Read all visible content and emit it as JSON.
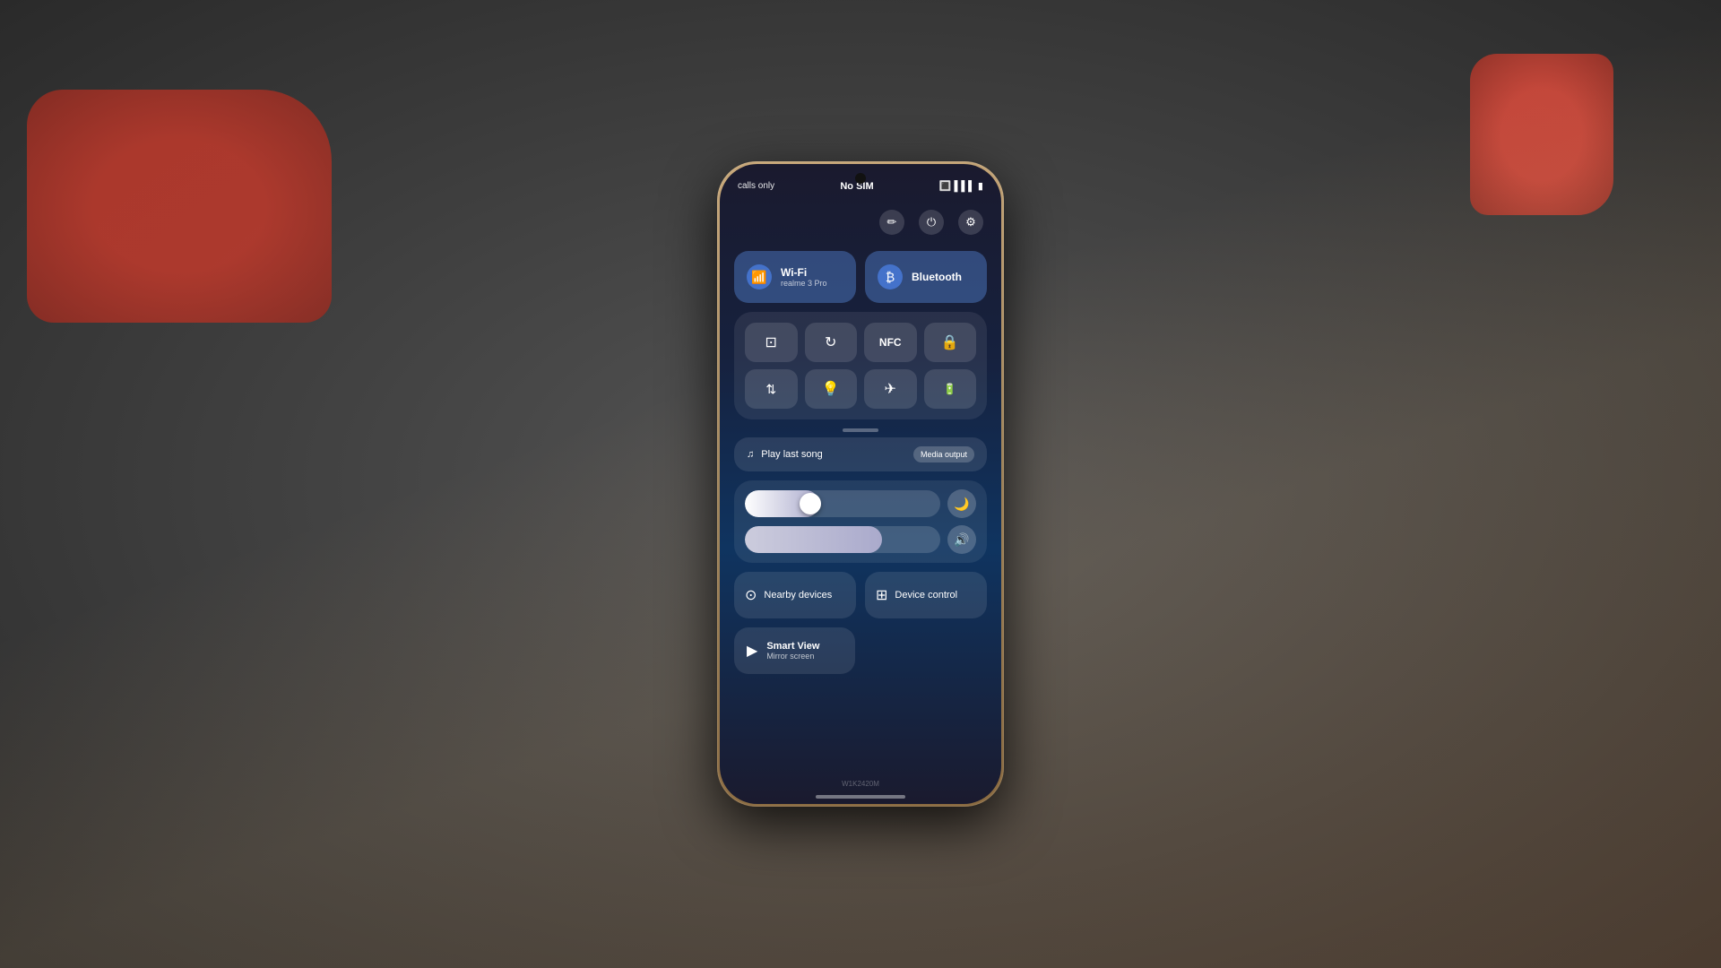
{
  "background": {
    "color": "#3a3a3a"
  },
  "status_bar": {
    "left": "calls only",
    "center": "No SIM",
    "battery_icon": "🔋",
    "signal_icon": "📶"
  },
  "top_icons": [
    {
      "id": "edit",
      "icon": "✏️",
      "label": "edit-icon"
    },
    {
      "id": "power",
      "icon": "⏻",
      "label": "power-icon"
    },
    {
      "id": "settings",
      "icon": "⚙",
      "label": "settings-icon"
    }
  ],
  "connectivity": {
    "wifi": {
      "label": "Wi-Fi",
      "subtitle": "realme 3 Pro",
      "active": true
    },
    "bluetooth": {
      "label": "Bluetooth",
      "subtitle": "",
      "active": true
    }
  },
  "toggles": [
    {
      "id": "screenshot",
      "icon": "⊞",
      "active": false,
      "label": "screenshot-toggle"
    },
    {
      "id": "sync",
      "icon": "↻",
      "active": false,
      "label": "sync-toggle"
    },
    {
      "id": "nfc",
      "icon": "N",
      "active": false,
      "label": "nfc-toggle"
    },
    {
      "id": "lock",
      "icon": "🔒",
      "active": false,
      "label": "screen-lock-toggle"
    },
    {
      "id": "data",
      "icon": "⇅",
      "active": false,
      "label": "mobile-data-toggle"
    },
    {
      "id": "flashlight",
      "icon": "🔦",
      "active": false,
      "label": "flashlight-toggle"
    },
    {
      "id": "airplane",
      "icon": "✈",
      "active": false,
      "label": "airplane-toggle"
    },
    {
      "id": "battery-save",
      "icon": "🔋",
      "active": false,
      "label": "battery-saver-toggle"
    }
  ],
  "media": {
    "song": "Play last song",
    "song_icon": "♫",
    "output_button": "Media output"
  },
  "sliders": {
    "brightness": {
      "value": 38,
      "icon_end": "🌙",
      "label": "brightness-slider"
    },
    "volume": {
      "value": 70,
      "icon_end": "🔊",
      "label": "volume-slider"
    }
  },
  "bottom_tiles": [
    {
      "id": "nearby",
      "icon": "⊙",
      "label": "Nearby devices"
    },
    {
      "id": "device-control",
      "icon": "⊞",
      "label": "Device control"
    }
  ],
  "smart_view": {
    "icon": "▶",
    "title": "Smart View",
    "subtitle": "Mirror screen"
  },
  "model_number": "W1K2420M"
}
